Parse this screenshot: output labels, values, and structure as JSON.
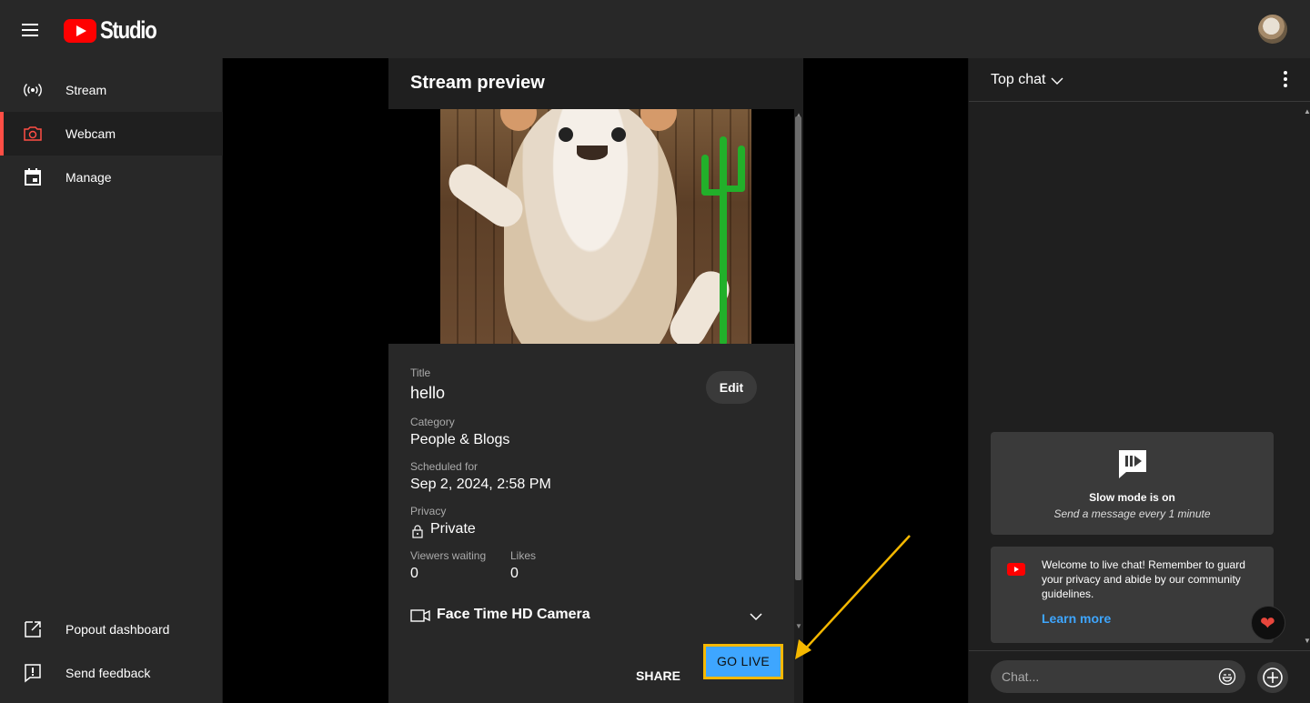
{
  "app": {
    "name": "Studio"
  },
  "sidebar": {
    "items": [
      {
        "label": "Stream",
        "icon": "broadcast-icon"
      },
      {
        "label": "Webcam",
        "icon": "camera-icon",
        "active": true
      },
      {
        "label": "Manage",
        "icon": "calendar-icon"
      }
    ],
    "bottom": [
      {
        "label": "Popout dashboard",
        "icon": "external-link-icon"
      },
      {
        "label": "Send feedback",
        "icon": "feedback-icon"
      }
    ]
  },
  "panel": {
    "title": "Stream preview",
    "edit_label": "Edit",
    "fields": {
      "title_label": "Title",
      "title_value": "hello",
      "category_label": "Category",
      "category_value": "People & Blogs",
      "scheduled_label": "Scheduled for",
      "scheduled_value": "Sep 2, 2024, 2:58 PM",
      "privacy_label": "Privacy",
      "privacy_value": "Private",
      "viewers_label": "Viewers waiting",
      "viewers_value": "0",
      "likes_label": "Likes",
      "likes_value": "0"
    },
    "camera": "Face Time HD Camera",
    "share_label": "SHARE",
    "golive_label": "GO LIVE"
  },
  "chat": {
    "title": "Top chat",
    "slow_title": "Slow mode is on",
    "slow_sub": "Send a message every 1 minute",
    "welcome": "Welcome to live chat! Remember to guard your privacy and abide by our community guidelines.",
    "learn_more": "Learn more",
    "input_placeholder": "Chat..."
  },
  "colors": {
    "accent_blue": "#3ea6ff",
    "highlight_yellow": "#f5b800",
    "brand_red": "#ff0000",
    "active_red": "#ff4e45"
  }
}
